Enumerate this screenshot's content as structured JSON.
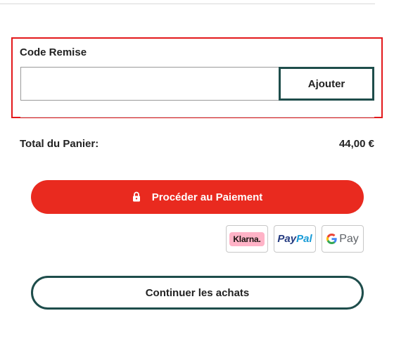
{
  "discount": {
    "title": "Code Remise",
    "input_value": "",
    "input_placeholder": "",
    "add_label": "Ajouter"
  },
  "cart": {
    "total_label": "Total du Panier:",
    "total_value": "44,00 €"
  },
  "checkout": {
    "label": "Procéder au Paiement",
    "icon": "lock-icon"
  },
  "payment_methods": {
    "klarna": "Klarna.",
    "paypal_pay": "Pay",
    "paypal_pal": "Pal",
    "gpay": "Pay"
  },
  "continue": {
    "label": "Continuer les achats"
  },
  "colors": {
    "accent_red": "#e92a1f",
    "highlight_border": "#e3191c",
    "teal_border": "#1e4d4b",
    "klarna_pink": "#ffb3c7"
  }
}
